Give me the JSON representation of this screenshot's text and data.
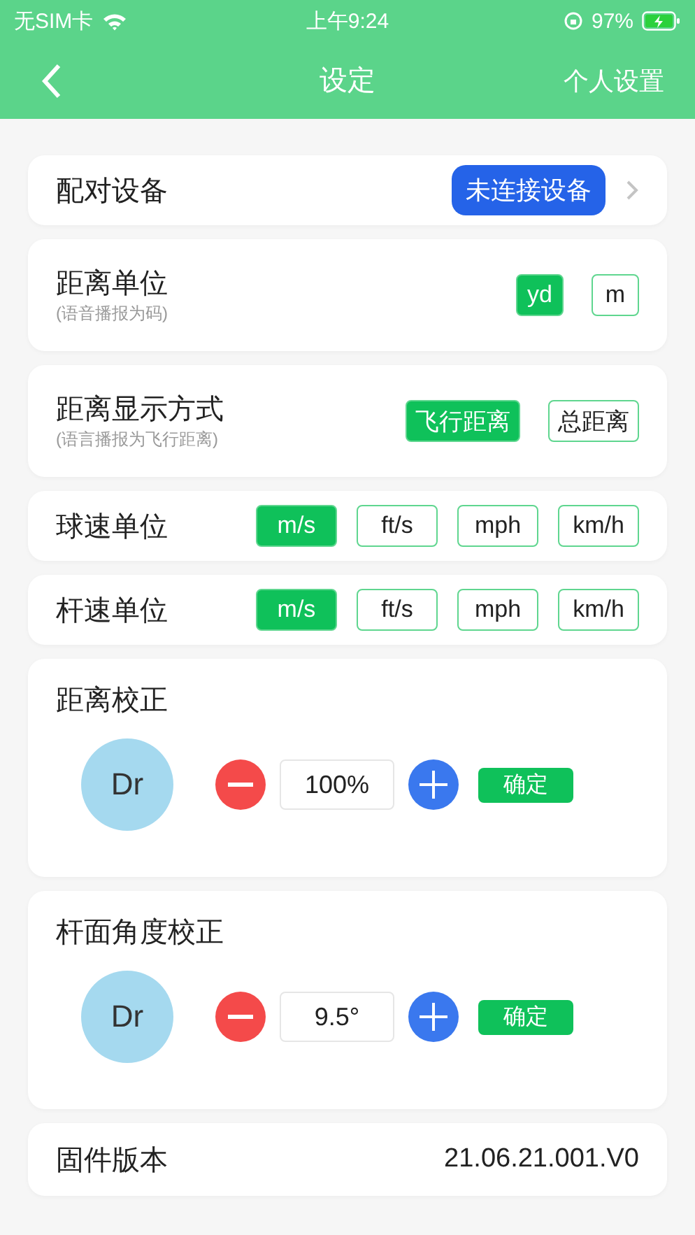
{
  "status_bar": {
    "carrier": "无SIM卡",
    "time": "上午9:24",
    "battery": "97%"
  },
  "nav": {
    "title": "设定",
    "action": "个人设置"
  },
  "sections": [
    {
      "kind": "device",
      "label": "配对设备",
      "button": "未连接设备"
    },
    {
      "kind": "options",
      "label": "距离单位",
      "note": "(语音播报为码)",
      "options": [
        {
          "label": "yd",
          "selected": true
        },
        {
          "label": "m",
          "selected": false
        }
      ]
    },
    {
      "kind": "options",
      "label": "距离显示方式",
      "note": "(语言播报为飞行距离)",
      "options": [
        {
          "label": "飞行距离",
          "selected": true
        },
        {
          "label": "总距离",
          "selected": false
        }
      ]
    },
    {
      "kind": "units",
      "label": "球速单位",
      "options": [
        {
          "label": "m/s",
          "selected": true
        },
        {
          "label": "ft/s",
          "selected": false
        },
        {
          "label": "mph",
          "selected": false
        },
        {
          "label": "km/h",
          "selected": false
        }
      ]
    },
    {
      "kind": "units",
      "label": "杆速单位",
      "options": [
        {
          "label": "m/s",
          "selected": true
        },
        {
          "label": "ft/s",
          "selected": false
        },
        {
          "label": "mph",
          "selected": false
        },
        {
          "label": "km/h",
          "selected": false
        }
      ]
    },
    {
      "kind": "calibration",
      "label": "距离校正",
      "avatar": "Dr",
      "value": "100%",
      "confirm": "确定"
    },
    {
      "kind": "calibration",
      "label": "杆面角度校正",
      "avatar": "Dr",
      "value": "9.5°",
      "confirm": "确定"
    },
    {
      "kind": "info",
      "label": "固件版本",
      "value": "21.06.21.001.V0"
    }
  ]
}
